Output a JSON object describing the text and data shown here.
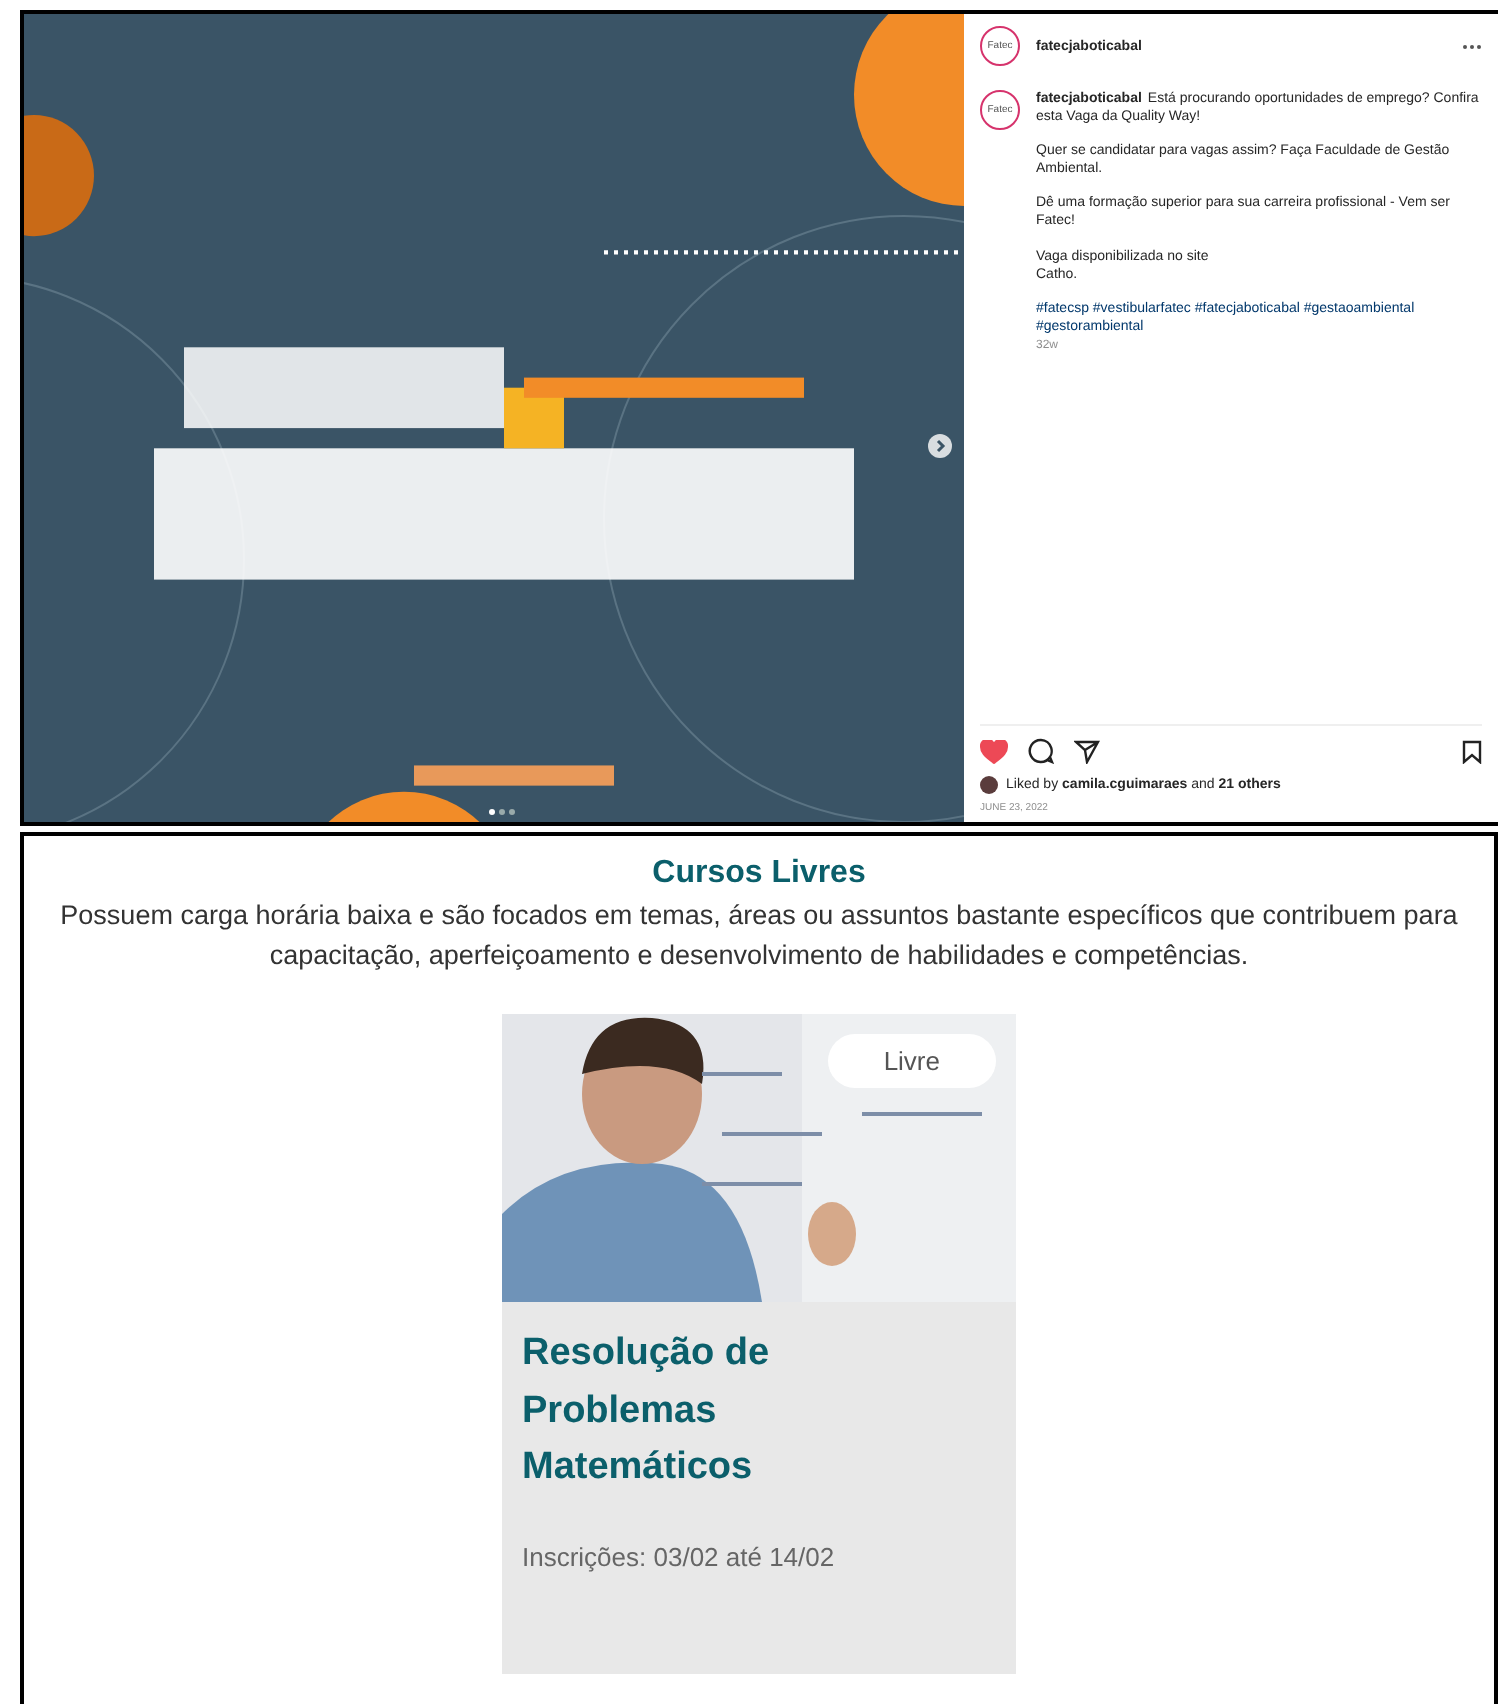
{
  "post": {
    "account": "fatecjaboticabal",
    "avatar_label": "Fatec",
    "caption": {
      "avatar_label": "Fatec",
      "author": "fatecjaboticabal",
      "paragraphs": [
        "Está procurando oportunidades de emprego? Confira esta Vaga da Quality Way!",
        "Quer se candidatar para vagas assim? Faça Faculdade de Gestão Ambiental.",
        "Dê uma formação superior para sua carreira profissional - Vem ser Fatec!",
        "Vaga disponibilizada no site\nCatho."
      ],
      "hashtags": "#fatecsp #vestibularfatec #fatecjaboticabal #gestaoambiental #gestorambiental",
      "age": "32w"
    },
    "liked": true,
    "likes": "Liked by **camila.cguimaraes** and **21 others**",
    "date": "JUNE 23, 2022"
  },
  "courses": {
    "title": "Cursos Livres",
    "description": "Possuem carga horária baixa e são focados em temas, áreas ou assuntos bastante específicos que contribuem para capacitação, aperfeiçoamento e desenvolvimento de habilidades e competências.",
    "card": {
      "badge": "Livre",
      "title": "Resolução de Problemas Matemáticos",
      "enrollment": "Inscrições: 03/02 até 14/02"
    }
  }
}
